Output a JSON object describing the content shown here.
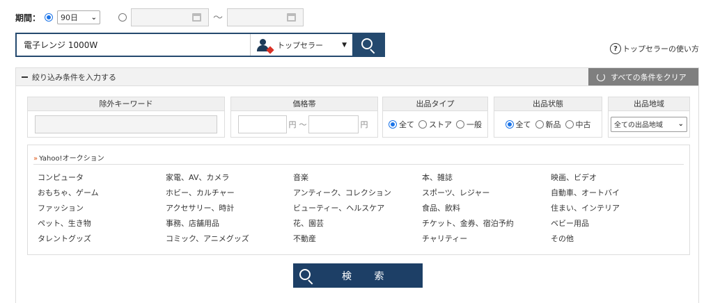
{
  "period": {
    "label": "期間：",
    "selected_option": "90日",
    "tilde": "〜"
  },
  "search": {
    "query": "電子レンジ 1000W",
    "seller_option": "トップセラー"
  },
  "help": {
    "label": "トップセラーの使い方",
    "icon_glyph": "?"
  },
  "panel": {
    "toggle_label": "絞り込み条件を入力する",
    "clear_label": "すべての条件をクリア"
  },
  "filters": {
    "exclude_keyword": {
      "title": "除外キーワード"
    },
    "price": {
      "title": "価格帯",
      "unit": "円",
      "tilde": "〜"
    },
    "listing_type": {
      "title": "出品タイプ",
      "options": [
        "全て",
        "ストア",
        "一般"
      ]
    },
    "condition": {
      "title": "出品状態",
      "options": [
        "全て",
        "新品",
        "中古"
      ]
    },
    "region": {
      "title": "出品地域",
      "selected": "全ての出品地域"
    }
  },
  "categories": {
    "title_bullet": "»",
    "title": "Yahoo!オークション",
    "items": [
      "コンピュータ",
      "家電、AV、カメラ",
      "音楽",
      "本、雑誌",
      "映画、ビデオ",
      "おもちゃ、ゲーム",
      "ホビー、カルチャー",
      "アンティーク、コレクション",
      "スポーツ、レジャー",
      "自動車、オートバイ",
      "ファッション",
      "アクセサリー、時計",
      "ビューティー、ヘルスケア",
      "食品、飲料",
      "住まい、インテリア",
      "ペット、生き物",
      "事務、店舗用品",
      "花、園芸",
      "チケット、金券、宿泊予約",
      "ベビー用品",
      "タレントグッズ",
      "コミック、アニメグッズ",
      "不動産",
      "チャリティー",
      "その他"
    ]
  },
  "submit": {
    "label": "検 索"
  },
  "colors": {
    "navy": "#24496e",
    "accent_blue": "#1a73e8",
    "clear_gray": "#7f7f7f"
  }
}
